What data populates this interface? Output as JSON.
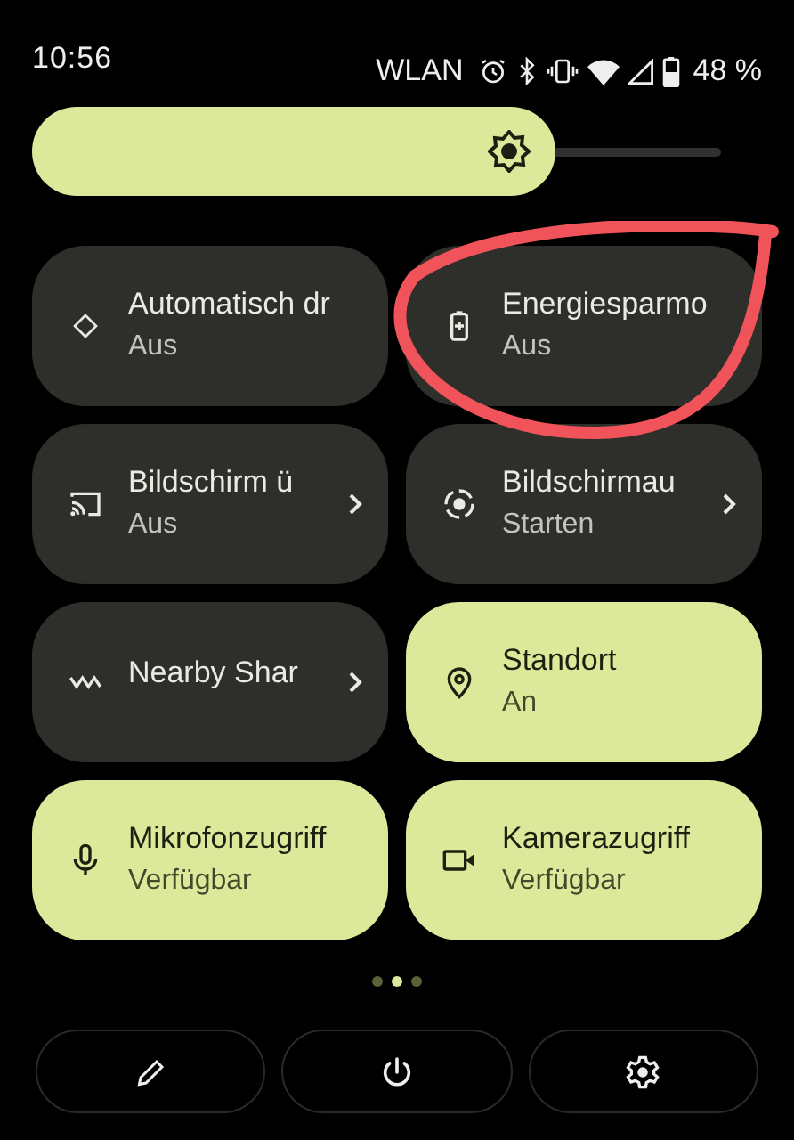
{
  "status_bar": {
    "time": "10:56",
    "network": "WLAN",
    "battery": "48 %"
  },
  "brightness": {
    "level": 0.76
  },
  "tiles": [
    {
      "title": "Automatisch dr",
      "subtitle": "Aus",
      "on": false,
      "chevron": false,
      "highlighted": false
    },
    {
      "title": "Energiesparmo",
      "subtitle": "Aus",
      "on": false,
      "chevron": false,
      "highlighted": true
    },
    {
      "title": "Bildschirm ü",
      "subtitle": "Aus",
      "on": false,
      "chevron": true,
      "highlighted": false
    },
    {
      "title": "Bildschirmau",
      "subtitle": "Starten",
      "on": false,
      "chevron": true,
      "highlighted": false
    },
    {
      "title": "Nearby Shar",
      "on": false,
      "chevron": true,
      "highlighted": false
    },
    {
      "title": "Standort",
      "subtitle": "An",
      "on": true,
      "chevron": false,
      "highlighted": false
    },
    {
      "title": "Mikrofonzugriff",
      "subtitle": "Verfügbar",
      "on": true,
      "chevron": false,
      "highlighted": false
    },
    {
      "title": "Kamerazugriff",
      "subtitle": "Verfügbar",
      "on": true,
      "chevron": false,
      "highlighted": false
    }
  ],
  "pages": [
    {
      "selected": false
    },
    {
      "selected": true
    },
    {
      "selected": false
    }
  ]
}
